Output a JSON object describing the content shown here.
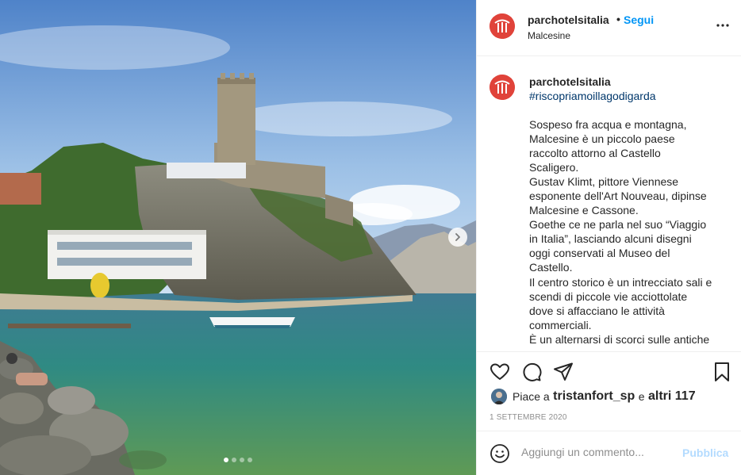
{
  "post": {
    "photo": {
      "alt": "",
      "carousel_total": 4,
      "carousel_index": 1
    },
    "header": {
      "username": "parchotelsitalia",
      "separator": "•",
      "follow_label": "Segui",
      "location": "Malcesine",
      "more_icon": "more-horizontal-icon"
    },
    "caption": {
      "username": "parchotelsitalia",
      "hashtag": "#riscopriamoillagodigarda",
      "lines": [
        "Sospeso fra acqua e montagna,",
        "Malcesine è un piccolo paese",
        "raccolto attorno al Castello",
        "Scaligero.",
        "Gustav Klimt, pittore Viennese",
        "esponente dell'Art Nouveau, dipinse",
        "Malcesine e Cassone.",
        "Goethe ce ne parla nel suo “Viaggio",
        "in Italia”, lasciando alcuni disegni",
        "oggi conservati al Museo del",
        "Castello.",
        "Il centro storico è un intrecciato sali e",
        "scendi di piccole vie acciottolate",
        "dove si affacciano le attività",
        "commerciali.",
        "È un alternarsi di scorci sulle antiche"
      ]
    },
    "likes": {
      "prefix": "Piace a",
      "user": "tristanfort_sp",
      "conj": "e",
      "others": "altri 117"
    },
    "date": "1 SETTEMBRE 2020",
    "comment": {
      "placeholder": "Aggiungi un commento...",
      "publish_label": "Pubblica"
    },
    "colors": {
      "brand": "#e0433a",
      "link": "#0095f6",
      "hashtag": "#00376b",
      "publish_disabled": "#b3dbff",
      "muted": "#8e8e8e"
    }
  }
}
